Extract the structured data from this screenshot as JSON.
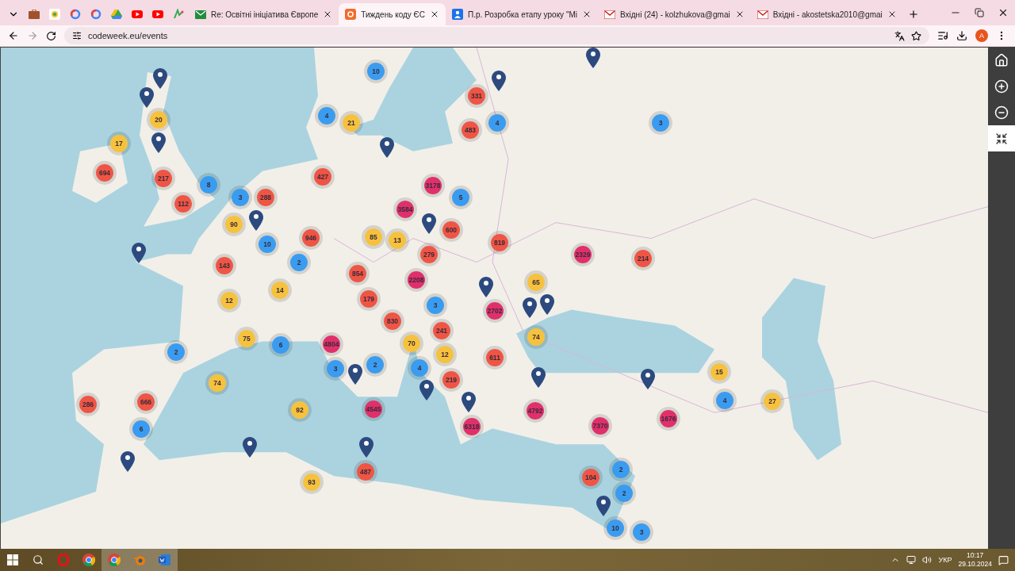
{
  "browser": {
    "tabs": [
      {
        "kind": "pinned",
        "selected": false
      },
      {
        "kind": "pinned",
        "selected": false
      },
      {
        "kind": "pinned",
        "selected": false
      },
      {
        "kind": "pinned",
        "selected": false
      },
      {
        "kind": "pinned",
        "selected": false
      },
      {
        "kind": "pinned",
        "selected": false
      },
      {
        "kind": "pinned",
        "selected": false
      },
      {
        "kind": "pinned",
        "selected": false
      },
      {
        "kind": "titled",
        "title": "Re: Освітні ініціатива Європе",
        "selected": false
      },
      {
        "kind": "titled",
        "title": "Тиждень коду ЄС",
        "selected": true
      },
      {
        "kind": "titled",
        "title": "П.р. Розробка етапу уроку \"Мі",
        "selected": false
      },
      {
        "kind": "titled",
        "title": "Вхідні (24) - kolzhukova@gmai",
        "selected": false
      },
      {
        "kind": "titled",
        "title": "Вхідні - akostetska2010@gmai",
        "selected": false
      }
    ],
    "url": "codeweek.eu/events",
    "profile_initial": "A"
  },
  "map": {
    "clusters": [
      {
        "count": "10",
        "color": "#3a9cf0"
      },
      {
        "count": "331",
        "color": "#ef5545"
      },
      {
        "count": "20",
        "color": "#f6c23e"
      },
      {
        "count": "4",
        "color": "#3a9cf0"
      },
      {
        "count": "21",
        "color": "#f6c23e"
      },
      {
        "count": "483",
        "color": "#ef5545"
      },
      {
        "count": "4",
        "color": "#3a9cf0"
      },
      {
        "count": "3",
        "color": "#3a9cf0"
      },
      {
        "count": "17",
        "color": "#f6c23e"
      },
      {
        "count": "694",
        "color": "#ef5545"
      },
      {
        "count": "217",
        "color": "#ef5545"
      },
      {
        "count": "427",
        "color": "#ef5545"
      },
      {
        "count": "8",
        "color": "#3a9cf0"
      },
      {
        "count": "3178",
        "color": "#e0306b"
      },
      {
        "count": "112",
        "color": "#ef5545"
      },
      {
        "count": "3",
        "color": "#3a9cf0"
      },
      {
        "count": "288",
        "color": "#ef5545"
      },
      {
        "count": "5",
        "color": "#3a9cf0"
      },
      {
        "count": "3584",
        "color": "#e0306b"
      },
      {
        "count": "90",
        "color": "#f6c23e"
      },
      {
        "count": "10",
        "color": "#3a9cf0"
      },
      {
        "count": "946",
        "color": "#ef5545"
      },
      {
        "count": "85",
        "color": "#f6c23e"
      },
      {
        "count": "13",
        "color": "#f6c23e"
      },
      {
        "count": "600",
        "color": "#ef5545"
      },
      {
        "count": "819",
        "color": "#ef5545"
      },
      {
        "count": "143",
        "color": "#ef5545"
      },
      {
        "count": "2",
        "color": "#3a9cf0"
      },
      {
        "count": "279",
        "color": "#ef5545"
      },
      {
        "count": "2329",
        "color": "#e0306b"
      },
      {
        "count": "214",
        "color": "#ef5545"
      },
      {
        "count": "854",
        "color": "#ef5545"
      },
      {
        "count": "2208",
        "color": "#e0306b"
      },
      {
        "count": "65",
        "color": "#f6c23e"
      },
      {
        "count": "12",
        "color": "#f6c23e"
      },
      {
        "count": "14",
        "color": "#f6c23e"
      },
      {
        "count": "179",
        "color": "#ef5545"
      },
      {
        "count": "830",
        "color": "#ef5545"
      },
      {
        "count": "3",
        "color": "#3a9cf0"
      },
      {
        "count": "2702",
        "color": "#e0306b"
      },
      {
        "count": "75",
        "color": "#f6c23e"
      },
      {
        "count": "70",
        "color": "#f6c23e"
      },
      {
        "count": "241",
        "color": "#ef5545"
      },
      {
        "count": "74",
        "color": "#f6c23e"
      },
      {
        "count": "2",
        "color": "#3a9cf0"
      },
      {
        "count": "6",
        "color": "#3a9cf0"
      },
      {
        "count": "4804",
        "color": "#e0306b"
      },
      {
        "count": "3",
        "color": "#3a9cf0"
      },
      {
        "count": "2",
        "color": "#3a9cf0"
      },
      {
        "count": "4",
        "color": "#3a9cf0"
      },
      {
        "count": "12",
        "color": "#f6c23e"
      },
      {
        "count": "611",
        "color": "#ef5545"
      },
      {
        "count": "74",
        "color": "#f6c23e"
      },
      {
        "count": "219",
        "color": "#ef5545"
      },
      {
        "count": "15",
        "color": "#f6c23e"
      },
      {
        "count": "286",
        "color": "#ef5545"
      },
      {
        "count": "666",
        "color": "#ef5545"
      },
      {
        "count": "92",
        "color": "#f6c23e"
      },
      {
        "count": "4545",
        "color": "#e0306b"
      },
      {
        "count": "4792",
        "color": "#e0306b"
      },
      {
        "count": "4",
        "color": "#3a9cf0"
      },
      {
        "count": "27",
        "color": "#f6c23e"
      },
      {
        "count": "6",
        "color": "#3a9cf0"
      },
      {
        "count": "6318",
        "color": "#e0306b"
      },
      {
        "count": "7370",
        "color": "#e0306b"
      },
      {
        "count": "1676",
        "color": "#e0306b"
      },
      {
        "count": "487",
        "color": "#ef5545"
      },
      {
        "count": "2",
        "color": "#3a9cf0"
      },
      {
        "count": "93",
        "color": "#f6c23e"
      },
      {
        "count": "104",
        "color": "#ef5545"
      },
      {
        "count": "2",
        "color": "#3a9cf0"
      },
      {
        "count": "10",
        "color": "#3a9cf0"
      },
      {
        "count": "3",
        "color": "#3a9cf0"
      }
    ]
  },
  "taskbar": {
    "language": "УКР",
    "time": "10:17",
    "date": "29.10.2024"
  }
}
